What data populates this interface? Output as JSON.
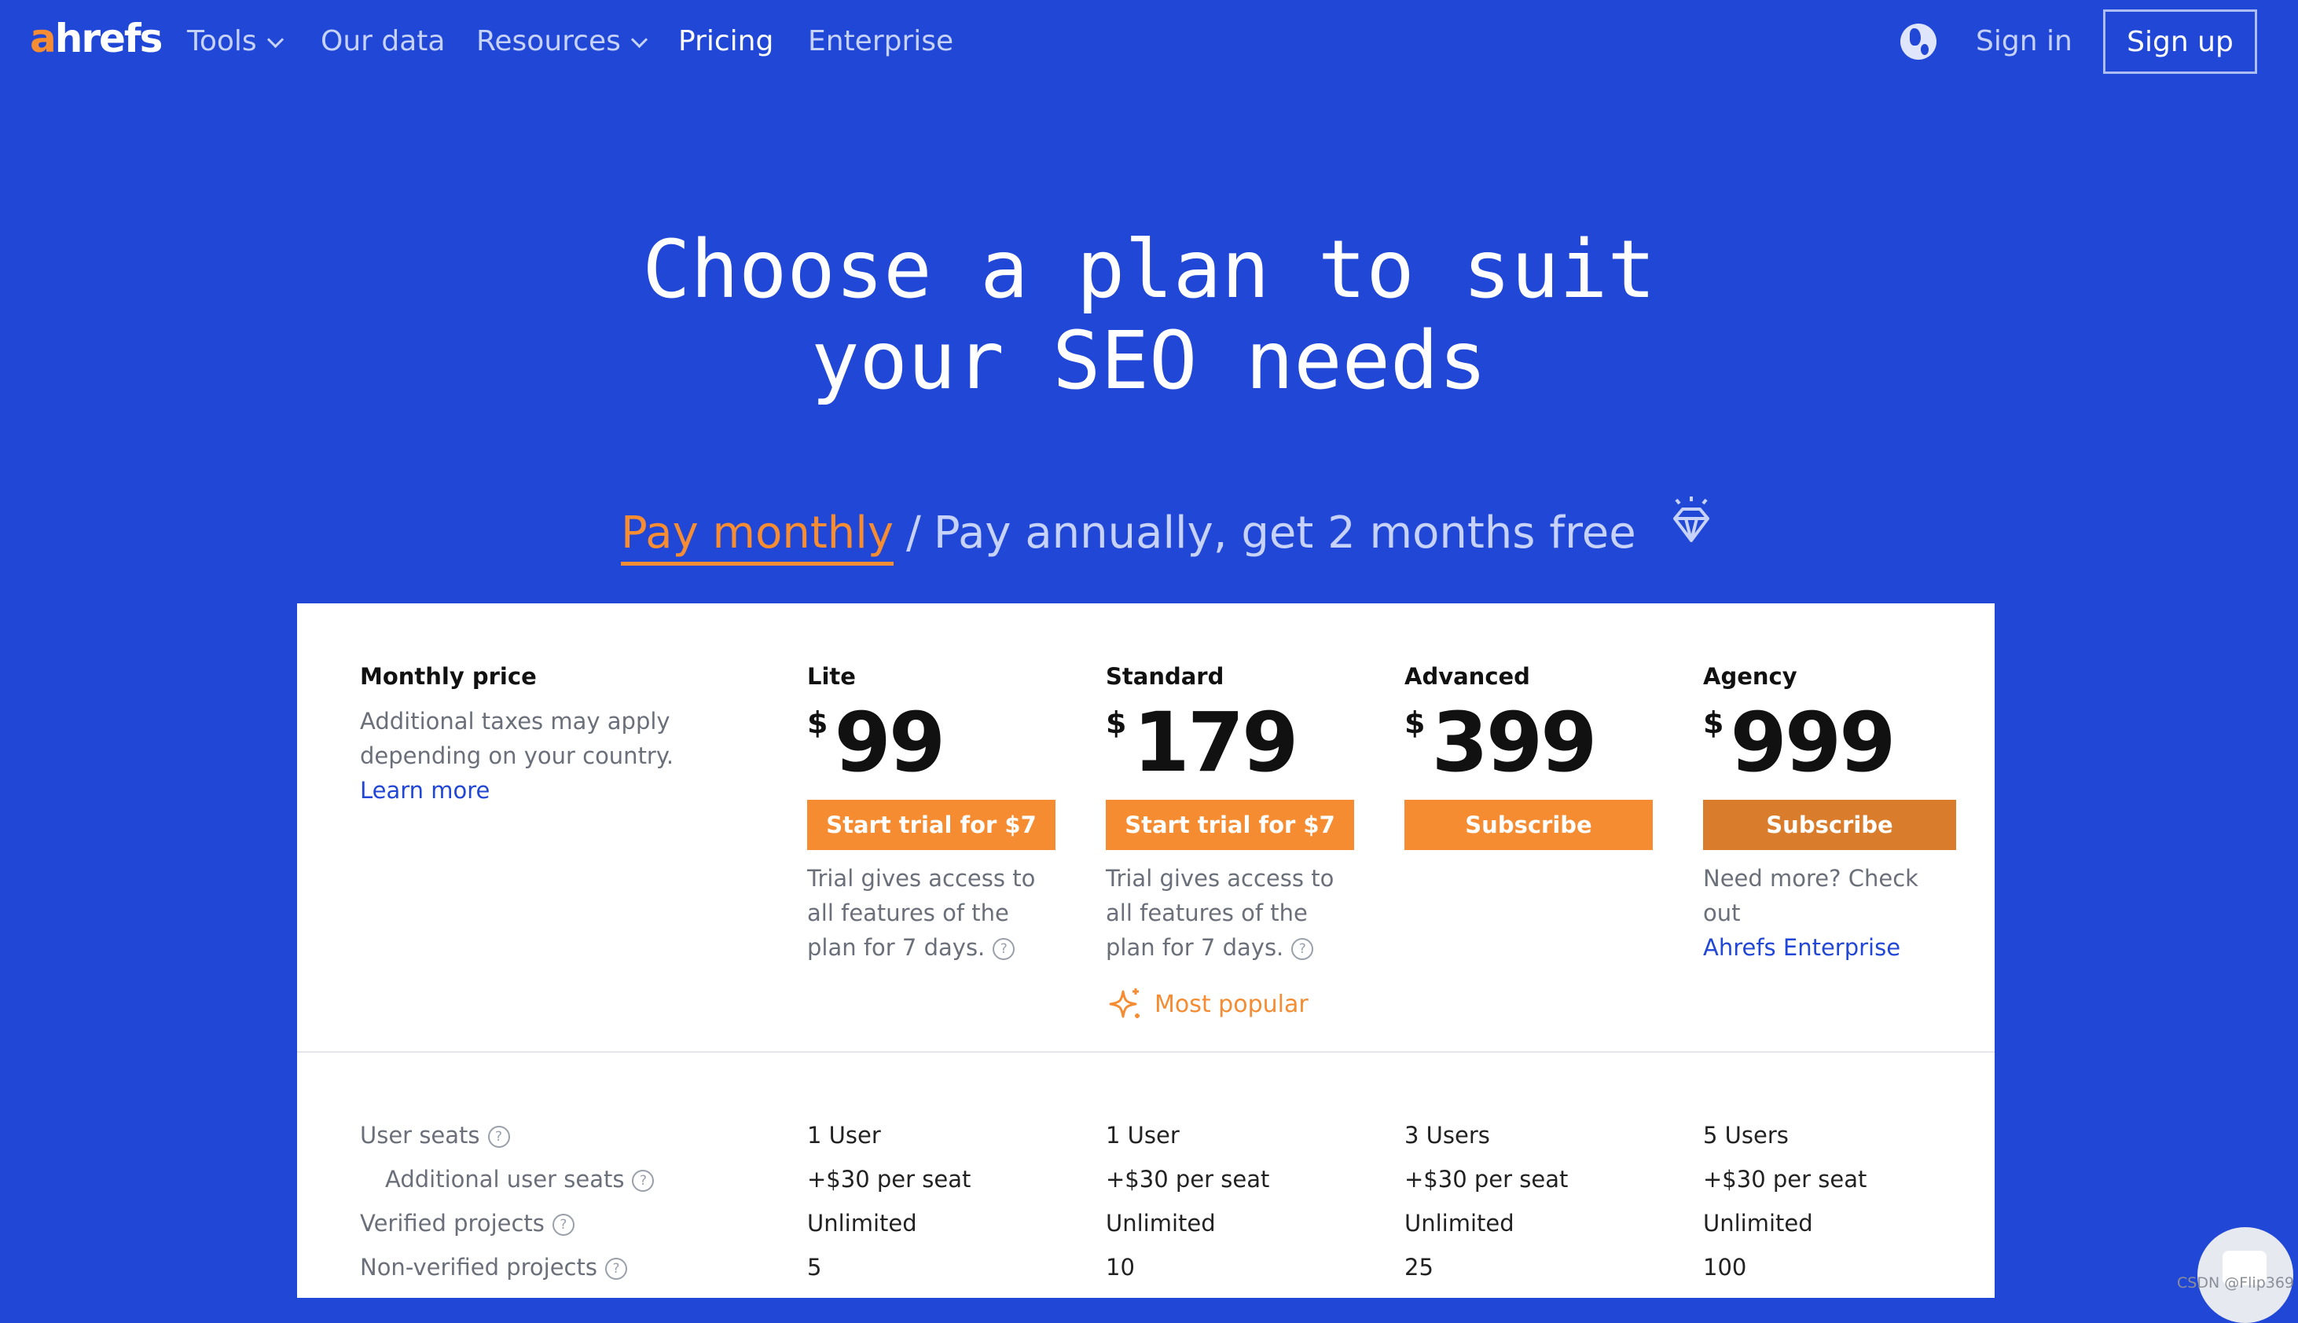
{
  "brand": {
    "logo_a": "a",
    "logo_rest": "hrefs",
    "accent": "#f68d33",
    "background": "#2147d6"
  },
  "nav": {
    "items": [
      {
        "label": "Tools",
        "dropdown": true
      },
      {
        "label": "Our data",
        "dropdown": false
      },
      {
        "label": "Resources",
        "dropdown": true
      },
      {
        "label": "Pricing",
        "dropdown": false,
        "active": true
      },
      {
        "label": "Enterprise",
        "dropdown": false
      }
    ],
    "globe_icon": "globe-icon",
    "sign_in": "Sign in",
    "sign_up": "Sign up"
  },
  "hero": {
    "line1": "Choose a plan to suit",
    "line2": "your SEO needs"
  },
  "billing": {
    "monthly": "Pay monthly",
    "separator": "/",
    "annually": "Pay annually, get 2 months free",
    "selected": "monthly",
    "icon": "diamond-icon"
  },
  "pricing": {
    "heading": "Monthly price",
    "subtext": "Additional taxes may apply depending on your country.",
    "learn_more": "Learn more",
    "currency": "$",
    "plans": [
      {
        "name": "Lite",
        "price": "99",
        "button": "Start trial for $7",
        "note": "Trial gives access to all features of the plan for 7 days."
      },
      {
        "name": "Standard",
        "price": "179",
        "button": "Start trial for $7",
        "note": "Trial gives access to all features of the plan for 7 days.",
        "badge": "Most popular"
      },
      {
        "name": "Advanced",
        "price": "399",
        "button": "Subscribe",
        "note": ""
      },
      {
        "name": "Agency",
        "price": "999",
        "button": "Subscribe",
        "note": "Need more? Check out",
        "link": "Ahrefs Enterprise"
      }
    ]
  },
  "features": [
    {
      "label": "User seats",
      "values": [
        "1 User",
        "1 User",
        "3 Users",
        "5 Users"
      ]
    },
    {
      "label": "Additional user seats",
      "values": [
        "+$30 per seat",
        "+$30 per seat",
        "+$30 per seat",
        "+$30 per seat"
      ]
    },
    {
      "label": "Verified projects",
      "values": [
        "Unlimited",
        "Unlimited",
        "Unlimited",
        "Unlimited"
      ]
    },
    {
      "label": "Non-verified projects",
      "values": [
        "5",
        "10",
        "25",
        "100"
      ]
    }
  ],
  "watermark": "CSDN @Flip369"
}
